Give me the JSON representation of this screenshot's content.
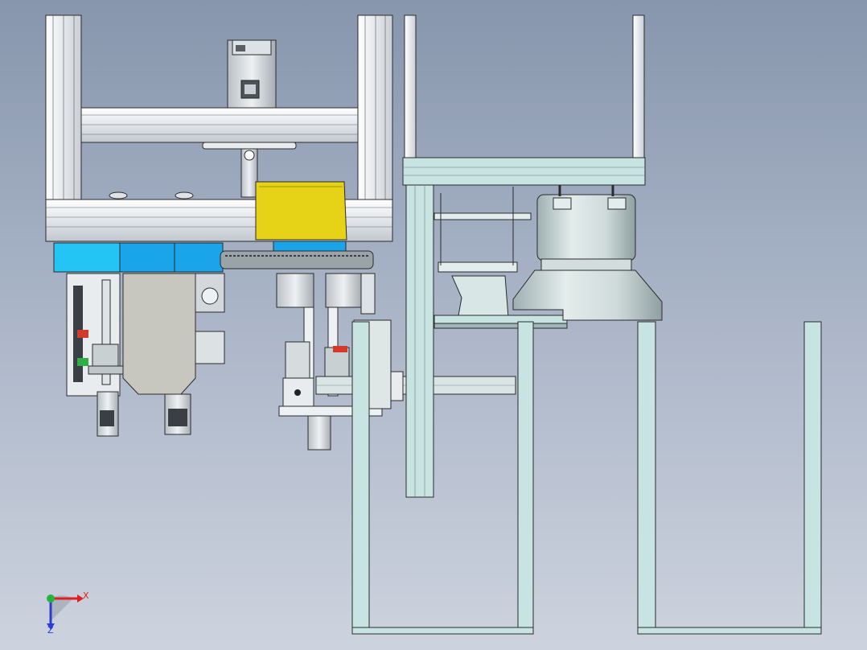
{
  "viewport": {
    "background_top": "#8796ad",
    "background_bottom": "#cdd3de"
  },
  "model": {
    "colors": {
      "frame": "#e7eaee",
      "frame_light": "#c7e4e2",
      "edge": "#2b2b2b",
      "yellow_guard": "#e6d216",
      "blue_block": "#1aa4ea",
      "blue_light": "#24c4f4",
      "steel": "#c9d0d2",
      "dark": "#3a3f45",
      "red_accent": "#d23a2a"
    }
  },
  "triad": {
    "x_label": "X",
    "z_label": "Z",
    "x_color": "#e02020",
    "y_color": "#22b53a",
    "z_color": "#2a3cd8"
  }
}
